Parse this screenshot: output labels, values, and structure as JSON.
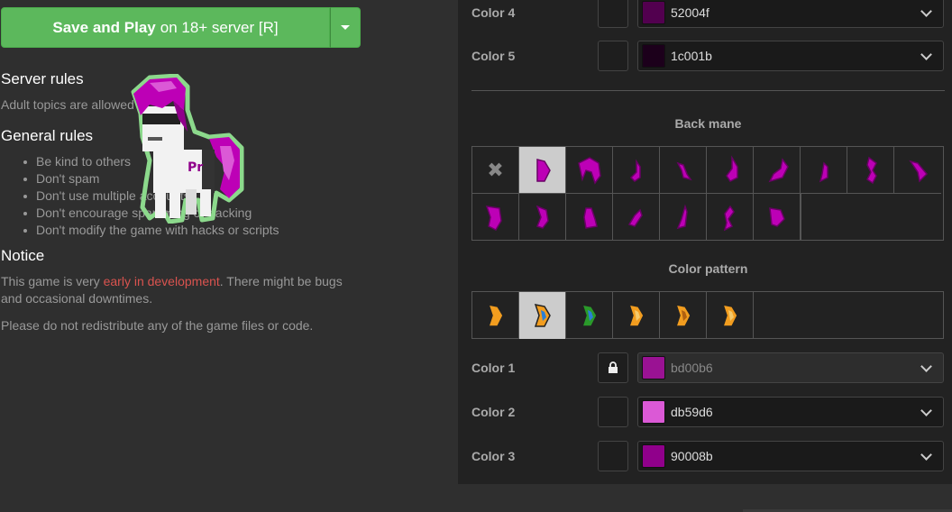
{
  "play": {
    "bold": "Save and Play",
    "rest": "on 18+ server [R]"
  },
  "server_rules": {
    "title": "Server rules",
    "text": "Adult topics are allowed"
  },
  "general_rules": {
    "title": "General rules",
    "items": [
      "Be kind to others",
      "Don't spam",
      "Don't use multiple accounts",
      "Don't encourage spamming or hacking",
      "Don't modify the game with hacks or scripts"
    ]
  },
  "notice": {
    "title": "Notice",
    "text_before": "This game is very ",
    "highlight": "early in development",
    "text_after": ". There might be bugs and occasional downtimes.",
    "redistribute": "Please do not redistribute any of the game files or code."
  },
  "colors_top": [
    {
      "label": "Color 4",
      "hex": "52004f",
      "swatch": "#52004f"
    },
    {
      "label": "Color 5",
      "hex": "1c001b",
      "swatch": "#1c001b"
    }
  ],
  "back_mane": {
    "title": "Back mane",
    "count": 17,
    "selected": 1
  },
  "color_pattern": {
    "title": "Color pattern",
    "selected": 1
  },
  "colors_bottom": [
    {
      "label": "Color 1",
      "hex": "bd00b6",
      "swatch": "#bd00b6",
      "locked": true
    },
    {
      "label": "Color 2",
      "hex": "db59d6",
      "swatch": "#db59d6",
      "locked": false
    },
    {
      "label": "Color 3",
      "hex": "90008b",
      "swatch": "#90008b",
      "locked": false
    }
  ],
  "accent": {
    "green": "#5cb85c",
    "red": "#d9534f",
    "mane": "#bd00b6"
  },
  "icons": {
    "caret": "caret-down-icon",
    "lock": "lock-icon",
    "chevron": "chevron-down-icon",
    "none": "x-icon"
  }
}
